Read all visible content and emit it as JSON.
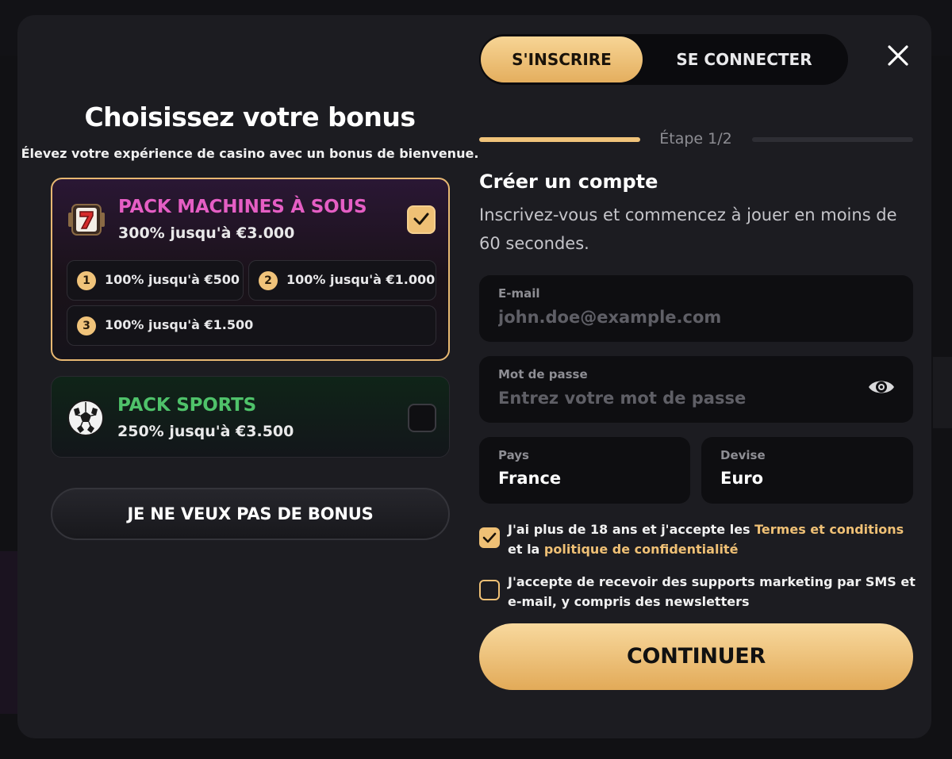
{
  "left_panel": {
    "title": "Choisissez votre bonus",
    "subtitle": "Élevez votre expérience de casino avec un bonus de bienvenue.",
    "packs": [
      {
        "icon": "slot-seven-icon",
        "name": "PACK MACHINES À SOUS",
        "amount": "300% jusqu'à €3.000",
        "selected": true,
        "name_color": "#e55ec4",
        "tiers": [
          {
            "num": "1",
            "label": "100% jusqu'à €500"
          },
          {
            "num": "2",
            "label": "100% jusqu'à €1.000"
          },
          {
            "num": "3",
            "label": "100% jusqu'à €1.500"
          }
        ]
      },
      {
        "icon": "soccer-ball-icon",
        "name": "PACK SPORTS",
        "amount": "250% jusqu'à €3.500",
        "selected": false,
        "name_color": "#4fc26a"
      }
    ],
    "no_bonus_label": "JE NE VEUX PAS DE BONUS"
  },
  "tabs": {
    "signup": "S'INSCRIRE",
    "login": "SE CONNECTER",
    "active": "signup"
  },
  "progress": {
    "label": "Étape 1/2",
    "step": 1,
    "total": 2
  },
  "form": {
    "title": "Créer un compte",
    "subtitle": "Inscrivez-vous et commencez à jouer en moins de 60 secondes.",
    "email": {
      "label": "E-mail",
      "placeholder": "john.doe@example.com",
      "value": ""
    },
    "password": {
      "label": "Mot de passe",
      "placeholder": "Entrez votre mot de passe",
      "value": ""
    },
    "country": {
      "label": "Pays",
      "value": "France"
    },
    "currency": {
      "label": "Devise",
      "value": "Euro"
    },
    "consent_age": {
      "checked": true,
      "text_before": "J'ai plus de 18 ans et j'accepte les ",
      "link_terms": "Termes et conditions",
      "text_mid": " et la ",
      "link_privacy": "politique de confidentialité"
    },
    "consent_marketing": {
      "checked": false,
      "text": "J'accepte de recevoir des supports marketing par SMS et e-mail, y compris des newsletters"
    },
    "continue_label": "CONTINUER"
  },
  "colors": {
    "accent": "#efc075",
    "modal_bg": "#1c1c21",
    "field_bg": "#0e0e11"
  }
}
